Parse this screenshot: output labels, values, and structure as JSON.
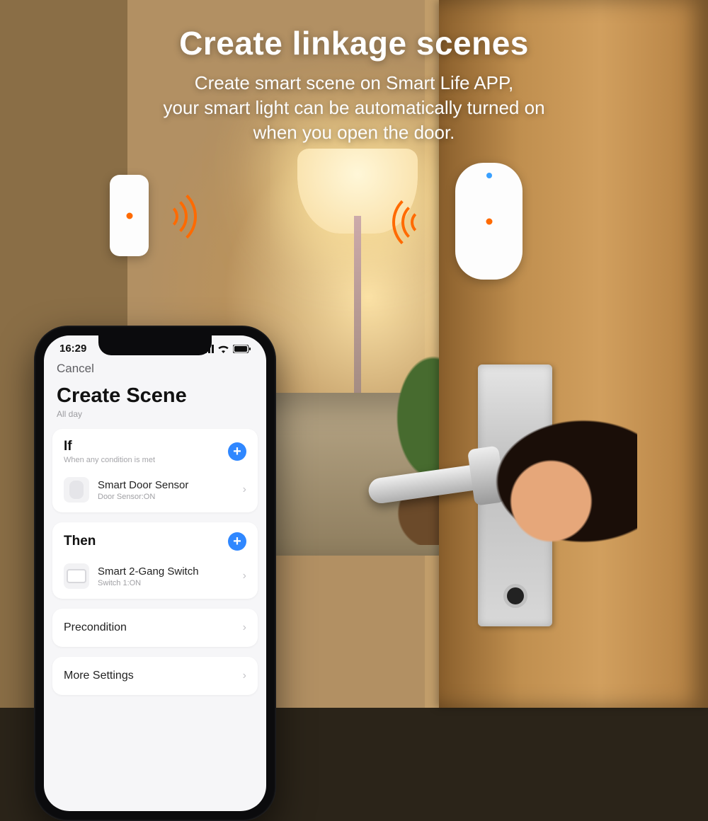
{
  "hero": {
    "title": "Create linkage scenes",
    "subtitle": "Create smart scene on Smart Life APP,\nyour smart light can be automatically turned on\nwhen you open the door."
  },
  "phone": {
    "status": {
      "time": "16:29"
    },
    "nav": {
      "cancel": "Cancel"
    },
    "page": {
      "title": "Create Scene",
      "subtitle": "All day"
    },
    "if": {
      "title": "If",
      "hint": "When any condition is met",
      "device": {
        "name": "Smart Door Sensor",
        "state": "Door Sensor:ON"
      }
    },
    "then": {
      "title": "Then",
      "device": {
        "name": "Smart 2-Gang Switch",
        "state": "Switch 1:ON"
      }
    },
    "rows": {
      "precondition": "Precondition",
      "more": "More Settings"
    }
  }
}
